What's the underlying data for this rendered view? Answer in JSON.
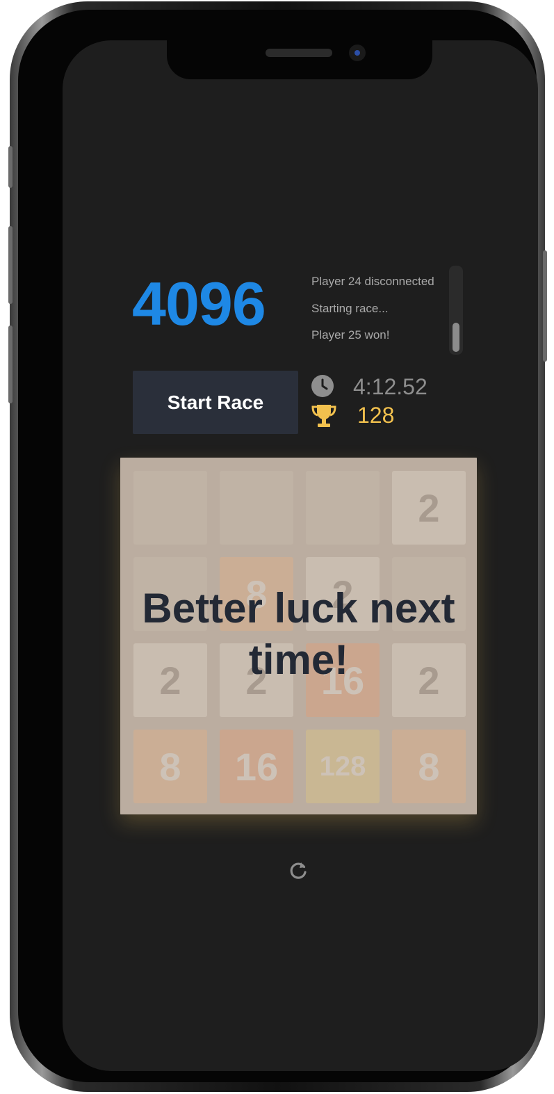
{
  "score": "4096",
  "feed": {
    "items": [
      "Player 24 disconnected",
      "Starting race...",
      "Player 25 won!"
    ]
  },
  "controls": {
    "start_label": "Start Race",
    "timer": "4:12.52",
    "best": "128"
  },
  "board": {
    "rows": [
      [
        "",
        "",
        "",
        "2"
      ],
      [
        "",
        "8",
        "2",
        ""
      ],
      [
        "2",
        "2",
        "16",
        "2"
      ],
      [
        "8",
        "16",
        "128",
        "8"
      ]
    ]
  },
  "overlay": {
    "message": "Better luck next time!"
  },
  "icons": {
    "clock": "clock-icon",
    "trophy": "trophy-icon",
    "restart": "restart-icon"
  },
  "colors": {
    "score": "#1e88e5",
    "best": "#f2c14e",
    "background": "#1e1e1e"
  }
}
